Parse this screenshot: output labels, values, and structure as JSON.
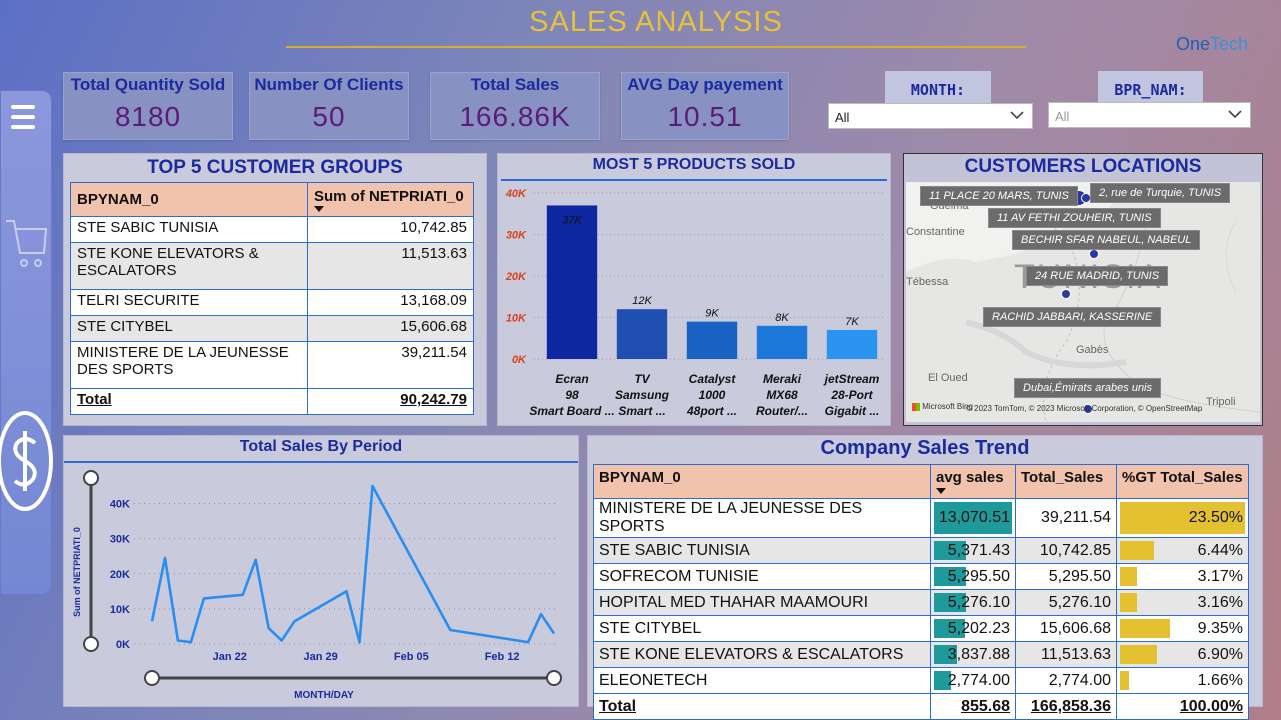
{
  "title": "SALES ANALYSIS",
  "logo": {
    "part1": "One",
    "part2": "Tech"
  },
  "kpis": [
    {
      "label": "Total Quantity Sold",
      "value": "8180"
    },
    {
      "label": "Number Of Clients",
      "value": "50"
    },
    {
      "label": "Total Sales",
      "value": "166.86K"
    },
    {
      "label": "AVG Day payement",
      "value": "10.51"
    }
  ],
  "slicers": {
    "month": {
      "label": "MONTH:",
      "value": "All"
    },
    "bpr": {
      "label": "BPR_NAM:",
      "value": "All"
    }
  },
  "top5": {
    "title": "TOP 5 CUSTOMER GROUPS",
    "headers": [
      "BPYNAM_0",
      "Sum of NETPRIATI_0"
    ],
    "rows": [
      [
        "STE SABIC TUNISIA",
        "10,742.85"
      ],
      [
        "STE KONE ELEVATORS & ESCALATORS",
        "11,513.63"
      ],
      [
        "TELRI SECURITE",
        "13,168.09"
      ],
      [
        "STE CITYBEL",
        "15,606.68"
      ],
      [
        "MINISTERE DE LA JEUNESSE DES SPORTS",
        "39,211.54"
      ]
    ],
    "total_label": "Total",
    "total_value": "90,242.79"
  },
  "products": {
    "title": "MOST 5 PRODUCTS SOLD",
    "chart_data": {
      "type": "bar",
      "categories": [
        "Ecran 98 Smart Board ...",
        "TV Samsung Smart ...",
        "Catalyst 1000 48port ...",
        "Meraki MX68 Router/...",
        "jetStream 28-Port Gigabit ..."
      ],
      "values": [
        37000,
        12000,
        9000,
        8000,
        7000
      ],
      "data_labels": [
        "37K",
        "12K",
        "9K",
        "8K",
        "7K"
      ],
      "ylim": [
        0,
        40000
      ],
      "yticks": [
        "0K",
        "10K",
        "20K",
        "30K",
        "40K"
      ],
      "colors": [
        "#0e27a0",
        "#1f4fb0",
        "#1a62c4",
        "#1c78d8",
        "#2a94f0"
      ],
      "grid": true
    }
  },
  "map": {
    "title": "CUSTOMERS LOCATIONS",
    "pins": [
      "11 PLACE 20 MARS, TUNIS",
      "2, rue de Turquie, TUNIS",
      "11 AV FETHI ZOUHEIR, TUNIS",
      "BECHIR SFAR NABEUL, NABEUL",
      "24 RUE MADRID, TUNIS",
      "RACHID JABBARI, KASSERINE",
      "Dubai,Émirats arabes unis"
    ],
    "places": [
      "Guelma",
      "Constantine",
      "Tébessa",
      "Gabès",
      "El Oued",
      "Tripoli",
      "TUNISIA"
    ],
    "attribution": "© 2023 TomTom, © 2023 Microsoft Corporation, © OpenStreetMap",
    "provider": "Microsoft Bing"
  },
  "period": {
    "title": "Total Sales By Period",
    "chart_data": {
      "type": "line",
      "xlabel": "MONTH/DAY",
      "ylabel": "Sum of NETPRIATI_0",
      "ylim": [
        0,
        45000
      ],
      "yticks": [
        "0K",
        "10K",
        "20K",
        "30K",
        "40K"
      ],
      "xticks": [
        "Jan 22",
        "Jan 29",
        "Feb 05",
        "Feb 12"
      ],
      "x": [
        "Jan 16",
        "Jan 17",
        "Jan 18",
        "Jan 19",
        "Jan 20",
        "Jan 23",
        "Jan 24",
        "Jan 25",
        "Jan 26",
        "Jan 27",
        "Jan 31",
        "Feb 01",
        "Feb 02",
        "Feb 08",
        "Feb 14",
        "Feb 15",
        "Feb 16"
      ],
      "values": [
        6500,
        24500,
        1000,
        500,
        13000,
        14000,
        24000,
        4500,
        1000,
        6500,
        15000,
        500,
        45000,
        4000,
        500,
        8500,
        3000
      ],
      "color": "#2a8ef0",
      "grid": true
    }
  },
  "trend": {
    "title": "Company Sales Trend",
    "headers": [
      "BPYNAM_0",
      "avg sales",
      "Total_Sales",
      "%GT Total_Sales"
    ],
    "rows": [
      {
        "name": "MINISTERE DE LA JEUNESSE DES SPORTS",
        "avg": "13,070.51",
        "avg_frac": 1.0,
        "total": "39,211.54",
        "pct": "23.50%",
        "pct_frac": 1.0
      },
      {
        "name": "STE SABIC TUNISIA",
        "avg": "5,371.43",
        "avg_frac": 0.41,
        "total": "10,742.85",
        "pct": "6.44%",
        "pct_frac": 0.274
      },
      {
        "name": "SOFRECOM TUNISIE",
        "avg": "5,295.50",
        "avg_frac": 0.405,
        "total": "5,295.50",
        "pct": "3.17%",
        "pct_frac": 0.135
      },
      {
        "name": "HOPITAL MED THAHAR MAAMOURI",
        "avg": "5,276.10",
        "avg_frac": 0.404,
        "total": "5,276.10",
        "pct": "3.16%",
        "pct_frac": 0.134
      },
      {
        "name": "STE CITYBEL",
        "avg": "5,202.23",
        "avg_frac": 0.398,
        "total": "15,606.68",
        "pct": "9.35%",
        "pct_frac": 0.398
      },
      {
        "name": "STE KONE ELEVATORS & ESCALATORS",
        "avg": "3,837.88",
        "avg_frac": 0.294,
        "total": "11,513.63",
        "pct": "6.90%",
        "pct_frac": 0.294
      },
      {
        "name": "ELEONETECH",
        "avg": "2,774.00",
        "avg_frac": 0.212,
        "total": "2,774.00",
        "pct": "1.66%",
        "pct_frac": 0.071
      }
    ],
    "total_label": "Total",
    "total_avg": "855.68",
    "total_sales": "166,858.36",
    "total_pct": "100.00%"
  }
}
